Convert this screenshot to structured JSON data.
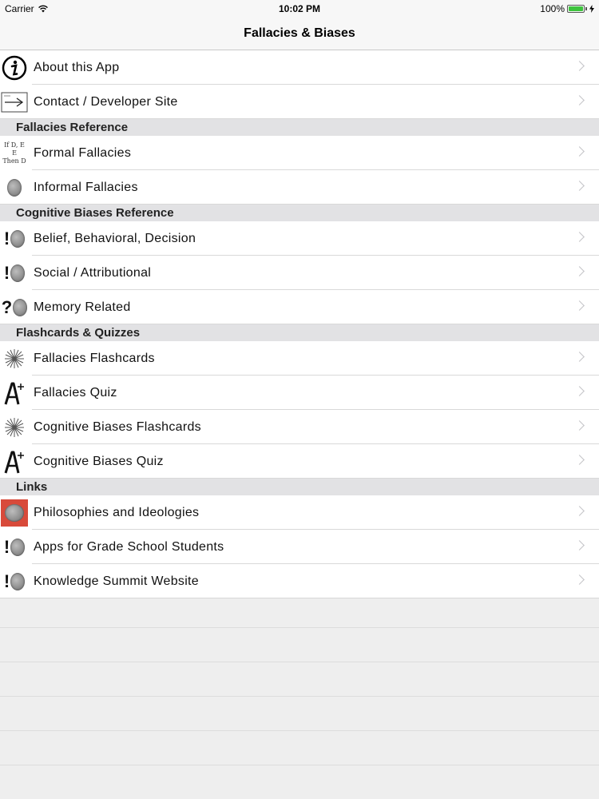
{
  "status_bar": {
    "carrier": "Carrier",
    "time": "10:02 PM",
    "battery": "100%",
    "battery_level": 1.0
  },
  "navbar": {
    "title": "Fallacies & Biases"
  },
  "rows": {
    "about": {
      "label": "About this App",
      "icon": "info-icon"
    },
    "contact": {
      "label": "Contact / Developer Site",
      "icon": "arrow-icon"
    },
    "formal": {
      "label": "Formal Fallacies",
      "icon": "logic-text-icon"
    },
    "informal": {
      "label": "Informal Fallacies",
      "icon": "brain-icon"
    },
    "belief": {
      "label": "Belief, Behavioral, Decision",
      "icon": "exclaim-brain-icon"
    },
    "social": {
      "label": "Social / Attributional",
      "icon": "exclaim-brain-icon"
    },
    "memory": {
      "label": "Memory Related",
      "icon": "question-brain-icon"
    },
    "fallacies_flashcards": {
      "label": "Fallacies Flashcards",
      "icon": "starburst-icon"
    },
    "fallacies_quiz": {
      "label": "Fallacies Quiz",
      "icon": "grade-a-plus-icon"
    },
    "biases_flashcards": {
      "label": "Cognitive Biases Flashcards",
      "icon": "starburst-icon"
    },
    "biases_quiz": {
      "label": "Cognitive Biases Quiz",
      "icon": "grade-a-plus-icon"
    },
    "philosophies": {
      "label": "Philosophies and Ideologies",
      "icon": "red-brain-icon"
    },
    "grade_school": {
      "label": "Apps for Grade School Students",
      "icon": "exclaim-brain-icon"
    },
    "summit": {
      "label": "Knowledge Summit Website",
      "icon": "exclaim-brain-icon"
    }
  },
  "sections": {
    "fallacies_reference": "Fallacies Reference",
    "biases_reference": "Cognitive Biases Reference",
    "flashcards_quizzes": "Flashcards & Quizzes",
    "links": "Links"
  },
  "icon_text": {
    "formal_line1": "If D, E",
    "formal_line2": "E",
    "formal_line3": "Then D",
    "exclaim": "!",
    "question": "?"
  }
}
